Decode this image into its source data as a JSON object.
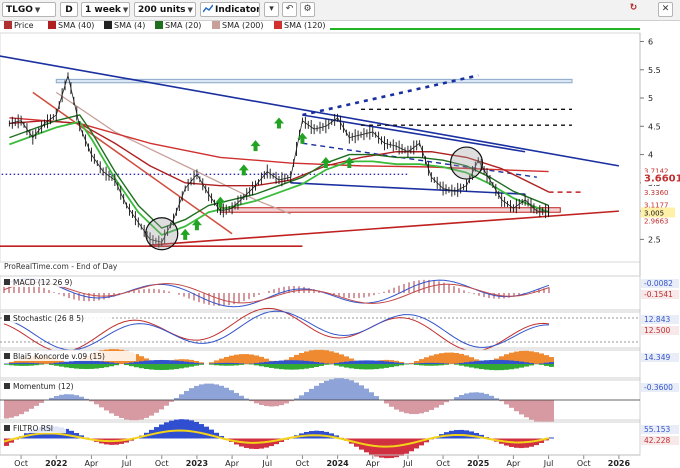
{
  "toolbar": {
    "symbol": "TLGO",
    "symbol_code": "D",
    "period": "1 week",
    "units": "200 units",
    "indicators_label": "Indicators",
    "icons": [
      "down-arrow-icon",
      "undo-icon",
      "settings-gear-icon",
      "refresh-icon",
      "close-icon"
    ]
  },
  "legend": [
    {
      "label": "Price",
      "color": "#b03030"
    },
    {
      "label": "SMA (40)",
      "color": "#b02020"
    },
    {
      "label": "SMA (4)",
      "color": "#222222"
    },
    {
      "label": "SMA (20)",
      "color": "#1f6f1f"
    },
    {
      "label": "SMA (200)",
      "color": "#c8a09a"
    },
    {
      "label": "SMA (120)",
      "color": "#d03030"
    }
  ],
  "source_text": "ProRealTime.com - End of Day",
  "chart_data": {
    "type": "line",
    "x_ticks": [
      "Oct",
      "2022",
      "Apr",
      "Jul",
      "Oct",
      "2023",
      "Apr",
      "Jul",
      "Oct",
      "2024",
      "Apr",
      "Jul",
      "Oct",
      "2025",
      "Apr",
      "Jul",
      "Oct",
      "2026"
    ],
    "y_ticks": [
      2.5,
      3,
      3.5,
      4,
      4.5,
      5,
      5.5,
      6
    ],
    "ylim": [
      2.1,
      6.15
    ],
    "price_labels": [
      {
        "text": "3.7142",
        "value": 3.7142,
        "color": "#c03030"
      },
      {
        "text": "3.6601",
        "value": 3.6601,
        "color": "#c03030"
      },
      {
        "text": "3.3360",
        "value": 3.336,
        "color": "#c03030"
      },
      {
        "text": "3.1177",
        "value": 3.1177,
        "color": "#c03030"
      },
      {
        "text": "3.005",
        "value": 3.005,
        "color": "#c03030"
      },
      {
        "text": "2.9663",
        "value": 2.9663,
        "color": "#c03030"
      }
    ],
    "price": [
      [
        "2021-09",
        4.55
      ],
      [
        "2021-10",
        4.6
      ],
      [
        "2021-11",
        4.3
      ],
      [
        "2021-12",
        4.55
      ],
      [
        "2022-01",
        4.7
      ],
      [
        "2022-02",
        5.4
      ],
      [
        "2022-03",
        4.5
      ],
      [
        "2022-04",
        4.0
      ],
      [
        "2022-05",
        3.7
      ],
      [
        "2022-06",
        3.55
      ],
      [
        "2022-07",
        3.1
      ],
      [
        "2022-08",
        2.8
      ],
      [
        "2022-09",
        2.5
      ],
      [
        "2022-10",
        2.45
      ],
      [
        "2022-11",
        2.85
      ],
      [
        "2022-12",
        3.4
      ],
      [
        "2023-01",
        3.65
      ],
      [
        "2023-02",
        3.3
      ],
      [
        "2023-03",
        3.0
      ],
      [
        "2023-04",
        3.05
      ],
      [
        "2023-05",
        3.25
      ],
      [
        "2023-06",
        3.45
      ],
      [
        "2023-07",
        3.7
      ],
      [
        "2023-08",
        3.55
      ],
      [
        "2023-09",
        3.6
      ],
      [
        "2023-10",
        4.6
      ],
      [
        "2023-11",
        4.45
      ],
      [
        "2023-12",
        4.5
      ],
      [
        "2024-01",
        4.65
      ],
      [
        "2024-02",
        4.3
      ],
      [
        "2024-03",
        4.35
      ],
      [
        "2024-04",
        4.4
      ],
      [
        "2024-05",
        4.2
      ],
      [
        "2024-06",
        4.15
      ],
      [
        "2024-07",
        4.05
      ],
      [
        "2024-08",
        4.2
      ],
      [
        "2024-09",
        3.6
      ],
      [
        "2024-10",
        3.4
      ],
      [
        "2024-11",
        3.35
      ],
      [
        "2024-12",
        3.45
      ],
      [
        "2025-01",
        3.9
      ],
      [
        "2025-02",
        3.55
      ],
      [
        "2025-03",
        3.2
      ],
      [
        "2025-04",
        3.05
      ],
      [
        "2025-05",
        3.2
      ],
      [
        "2025-06",
        3.0
      ],
      [
        "2025-07",
        3.0
      ]
    ],
    "sma20": [
      [
        "2021-09",
        4.3
      ],
      [
        "2021-11",
        4.45
      ],
      [
        "2022-01",
        4.6
      ],
      [
        "2022-03",
        4.7
      ],
      [
        "2022-04",
        4.4
      ],
      [
        "2022-06",
        3.7
      ],
      [
        "2022-08",
        3.1
      ],
      [
        "2022-10",
        2.7
      ],
      [
        "2022-12",
        2.85
      ],
      [
        "2023-02",
        3.1
      ],
      [
        "2023-04",
        3.2
      ],
      [
        "2023-06",
        3.3
      ],
      [
        "2023-08",
        3.45
      ],
      [
        "2023-10",
        3.6
      ],
      [
        "2023-12",
        3.85
      ],
      [
        "2024-02",
        4.0
      ],
      [
        "2024-04",
        4.0
      ],
      [
        "2024-06",
        3.95
      ],
      [
        "2024-08",
        3.95
      ],
      [
        "2024-10",
        3.9
      ],
      [
        "2024-12",
        3.8
      ],
      [
        "2025-02",
        3.6
      ],
      [
        "2025-04",
        3.35
      ],
      [
        "2025-07",
        3.1
      ]
    ],
    "sma40": [
      [
        "2021-09",
        4.55
      ],
      [
        "2021-12",
        4.6
      ],
      [
        "2022-03",
        4.55
      ],
      [
        "2022-06",
        4.2
      ],
      [
        "2022-09",
        3.8
      ],
      [
        "2022-12",
        3.5
      ],
      [
        "2023-03",
        3.45
      ],
      [
        "2023-06",
        3.45
      ],
      [
        "2023-09",
        3.55
      ],
      [
        "2023-12",
        3.8
      ],
      [
        "2024-03",
        3.95
      ],
      [
        "2024-06",
        4.05
      ],
      [
        "2024-09",
        4.05
      ],
      [
        "2024-12",
        3.95
      ],
      [
        "2025-03",
        3.75
      ],
      [
        "2025-07",
        3.34
      ]
    ],
    "sma120": [
      [
        "2021-09",
        4.65
      ],
      [
        "2022-03",
        4.55
      ],
      [
        "2022-09",
        4.2
      ],
      [
        "2023-03",
        3.95
      ],
      [
        "2023-09",
        3.85
      ],
      [
        "2024-03",
        3.8
      ],
      [
        "2024-09",
        3.78
      ],
      [
        "2025-03",
        3.73
      ],
      [
        "2025-07",
        3.7
      ]
    ],
    "sma200": [
      [
        "2022-01",
        5.1
      ],
      [
        "2022-06",
        4.4
      ],
      [
        "2022-12",
        3.8
      ],
      [
        "2023-06",
        3.2
      ],
      [
        "2023-09",
        2.95
      ]
    ],
    "trendlines": [
      {
        "from": [
          "2021-08",
          5.75
        ],
        "to": [
          "2026-01",
          3.8
        ],
        "color": "#1a2fa0",
        "style": "solid"
      },
      {
        "from": [
          "2023-10",
          4.7
        ],
        "to": [
          "2025-05",
          4.05
        ],
        "color": "#1a2fa0",
        "style": "solid"
      },
      {
        "from": [
          "2023-10",
          4.2
        ],
        "to": [
          "2025-06",
          3.6
        ],
        "color": "#1a2fa0",
        "style": "dashed"
      },
      {
        "from": [
          "2023-10",
          4.7
        ],
        "to": [
          "2025-01",
          5.4
        ],
        "color": "#1a2fa0",
        "style": "dashed"
      },
      {
        "from": [
          "2023-09",
          3.5
        ],
        "to": [
          "2025-05",
          3.3
        ],
        "color": "#1a2fa0",
        "style": "solid"
      },
      {
        "from": [
          "2022-09",
          2.4
        ],
        "to": [
          "2026-01",
          3.0
        ],
        "color": "#c02020",
        "style": "solid"
      },
      {
        "from": [
          "2021-08",
          2.38
        ],
        "to": [
          "2023-10",
          2.38
        ],
        "color": "#c02020",
        "style": "solid"
      },
      {
        "from": [
          "2024-03",
          4.8
        ],
        "to": [
          "2025-09",
          4.8
        ],
        "color": "#111111",
        "style": "dashed"
      },
      {
        "from": [
          "2024-03",
          4.52
        ],
        "to": [
          "2025-09",
          4.52
        ],
        "color": "#111111",
        "style": "dashed"
      },
      {
        "from": [
          "2021-08",
          3.65
        ],
        "to": [
          "2024-07",
          3.65
        ],
        "color": "#2a2ab0",
        "style": "dotted"
      },
      {
        "from": [
          "2025-07",
          3.336
        ],
        "to": [
          "2025-10",
          3.336
        ],
        "color": "#c02020",
        "style": "dashed"
      },
      {
        "from": [
          "2021-11",
          5.1
        ],
        "to": [
          "2023-04",
          2.6
        ],
        "color": "#d05040",
        "style": "solid"
      }
    ],
    "zones": [
      {
        "from": [
          "2022-01",
          5.33
        ],
        "to": [
          "2025-09",
          5.27
        ],
        "fill": "#dbe7f5",
        "stroke": "#8aa7c8"
      },
      {
        "from": [
          "2023-03",
          3.06
        ],
        "to": [
          "2025-08",
          2.98
        ],
        "fill": "#f3d3d3",
        "stroke": "#c02020"
      }
    ],
    "circles": [
      {
        "at": [
          "2022-10",
          2.6
        ]
      },
      {
        "at": [
          "2024-12",
          3.85
        ]
      }
    ],
    "buy_arrows": [
      [
        "2022-12",
        2.58
      ],
      [
        "2023-01",
        2.75
      ],
      [
        "2023-03",
        3.15
      ],
      [
        "2023-05",
        3.72
      ],
      [
        "2023-06",
        4.15
      ],
      [
        "2023-08",
        4.55
      ],
      [
        "2023-10",
        4.28
      ],
      [
        "2023-12",
        3.85
      ],
      [
        "2024-02",
        3.85
      ]
    ]
  },
  "subpanels": [
    {
      "label": "MACD (12 26 9)",
      "values": [
        "-0.0082",
        "-0.1541"
      ]
    },
    {
      "label": "Stochastic (26 8 5)",
      "values": [
        "12.843",
        "12.500"
      ]
    },
    {
      "label": "Blai5 Koncorde v.09 (15)",
      "values": [
        "14.349"
      ]
    },
    {
      "label": "Momentum (12)",
      "values": [
        "-0.3600"
      ]
    },
    {
      "label": "FILTRO RSI",
      "values": [
        "55.153",
        "42.228"
      ]
    }
  ]
}
